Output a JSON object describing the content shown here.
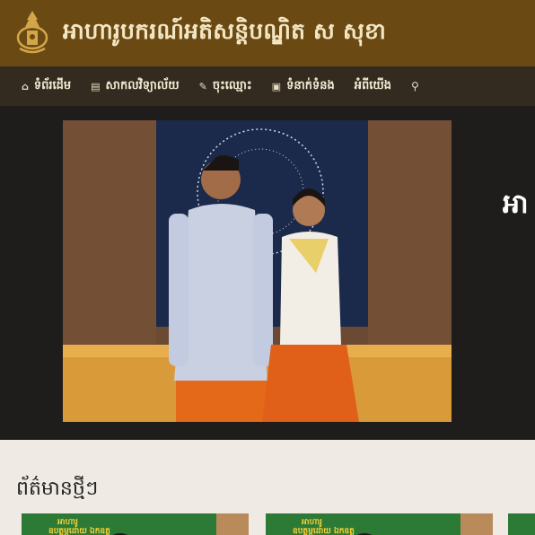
{
  "site": {
    "title": "អាហារូបករណ៍អតិសន្តិបណ្ឌិត ស សុខា"
  },
  "nav": {
    "items": [
      {
        "icon": "home-icon",
        "glyph": "⌂",
        "label": "ទំព័រដើម"
      },
      {
        "icon": "university-icon",
        "glyph": "▤",
        "label": "សាកលវិទ្យាល័យ"
      },
      {
        "icon": "edit-icon",
        "glyph": "✎",
        "label": "ចុះឈ្មោះ"
      },
      {
        "icon": "contact-card-icon",
        "glyph": "▣",
        "label": "ទំនាក់ទំនង"
      },
      {
        "label": "អំពីយើង"
      }
    ],
    "search_glyph": "⚲"
  },
  "hero": {
    "peek_text": "អា"
  },
  "news": {
    "heading": "ព័ត៌មានថ្មីៗ",
    "cards": [
      {
        "banner_line1": "អាហារូ",
        "banner_line2": "ឧបត្ថម្ភដោយ ឯកឧត្ត"
      },
      {
        "banner_line1": "អាហារូ",
        "banner_line2": "ឧបត្ថម្ភដោយ ឯកឧត្ត"
      }
    ]
  },
  "colors": {
    "header_bg": "#6a4a12",
    "nav_bg": "#332b20",
    "hero_bg": "#1f1d1b",
    "news_bg": "#efeae4"
  }
}
